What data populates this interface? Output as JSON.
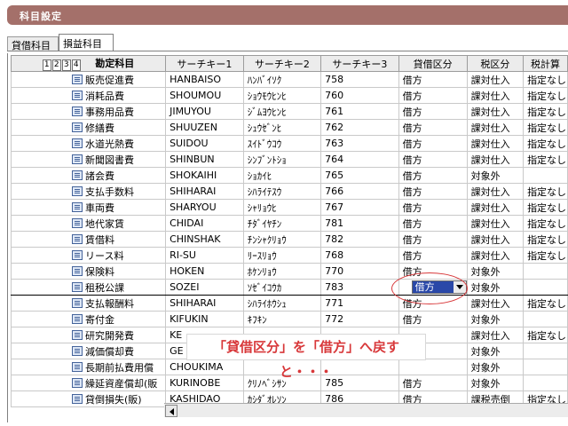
{
  "window": {
    "title": "科目設定"
  },
  "tabs": [
    {
      "label": "貸借科目",
      "active": false
    },
    {
      "label": "損益科目",
      "active": true
    }
  ],
  "grid": {
    "levels": [
      "1",
      "2",
      "3",
      "4"
    ],
    "headers": {
      "account": "勘定科目",
      "key1": "サーチキー1",
      "key2": "サーチキー2",
      "key3": "サーチキー3",
      "dc": "貸借区分",
      "tax": "税区分",
      "taxcalc": "税計算"
    },
    "rows": [
      {
        "name": "販売促進費",
        "key1": "HANBAISO",
        "key2": "ﾊﾝﾊﾞｲｿｸ",
        "key3": "758",
        "dc": "借方",
        "tax": "課対仕入",
        "taxcalc": "指定なし"
      },
      {
        "name": "消耗品費",
        "key1": "SHOUMOU",
        "key2": "ｼｮｳﾓｳﾋﾝﾋ",
        "key3": "760",
        "dc": "借方",
        "tax": "課対仕入",
        "taxcalc": "指定なし"
      },
      {
        "name": "事務用品費",
        "key1": "JIMUYOU",
        "key2": "ｼﾞﾑﾖｳﾋﾝﾋ",
        "key3": "761",
        "dc": "借方",
        "tax": "課対仕入",
        "taxcalc": "指定なし"
      },
      {
        "name": "修繕費",
        "key1": "SHUUZEN",
        "key2": "ｼｭｳｾﾞﾝﾋ",
        "key3": "762",
        "dc": "借方",
        "tax": "課対仕入",
        "taxcalc": "指定なし"
      },
      {
        "name": "水道光熱費",
        "key1": "SUIDOU",
        "key2": "ｽｲﾄﾞｳｺｳ",
        "key3": "763",
        "dc": "借方",
        "tax": "課対仕入",
        "taxcalc": "指定なし"
      },
      {
        "name": "新聞図書費",
        "key1": "SHINBUN",
        "key2": "ｼﾝﾌﾞﾝﾄｼｮ",
        "key3": "764",
        "dc": "借方",
        "tax": "課対仕入",
        "taxcalc": "指定なし"
      },
      {
        "name": "諸会費",
        "key1": "SHOKAIHI",
        "key2": "ｼｮｶｲﾋ",
        "key3": "765",
        "dc": "借方",
        "tax": "対象外",
        "taxcalc": ""
      },
      {
        "name": "支払手数料",
        "key1": "SHIHARAI",
        "key2": "ｼﾊﾗｲﾃｽｳ",
        "key3": "766",
        "dc": "借方",
        "tax": "課対仕入",
        "taxcalc": "指定なし"
      },
      {
        "name": "車両費",
        "key1": "SHARYOU",
        "key2": "ｼｬﾘｮｳﾋ",
        "key3": "767",
        "dc": "借方",
        "tax": "課対仕入",
        "taxcalc": "指定なし"
      },
      {
        "name": "地代家賃",
        "key1": "CHIDAI",
        "key2": "ﾁﾀﾞｲﾔﾁﾝ",
        "key3": "781",
        "dc": "借方",
        "tax": "課対仕入",
        "taxcalc": "指定なし"
      },
      {
        "name": "賃借料",
        "key1": "CHINSHAK",
        "key2": "ﾁﾝｼｬｸﾘｮｳ",
        "key3": "782",
        "dc": "借方",
        "tax": "課対仕入",
        "taxcalc": "指定なし"
      },
      {
        "name": "リース料",
        "key1": "RI-SU",
        "key2": "ﾘｰｽﾘｮｳ",
        "key3": "768",
        "dc": "借方",
        "tax": "課対仕入",
        "taxcalc": "指定なし"
      },
      {
        "name": "保険料",
        "key1": "HOKEN",
        "key2": "ﾎｹﾝﾘｮｳ",
        "key3": "770",
        "dc": "借方",
        "tax": "対象外",
        "taxcalc": ""
      },
      {
        "name": "租税公課",
        "key1": "SOZEI",
        "key2": "ｿｾﾞｲｺｳｶ",
        "key3": "783",
        "dc": "借方",
        "tax": "対象外",
        "taxcalc": "",
        "selected": true
      },
      {
        "name": "支払報酬料",
        "key1": "SHIHARAI",
        "key2": "ｼﾊﾗｲﾎｳｼｭ",
        "key3": "771",
        "dc": "借方",
        "tax": "課対仕入",
        "taxcalc": "指定なし"
      },
      {
        "name": "寄付金",
        "key1": "KIFUKIN",
        "key2": "ｷﾌｷﾝ",
        "key3": "772",
        "dc": "借方",
        "tax": "対象外",
        "taxcalc": ""
      },
      {
        "name": "研究開発費",
        "key1": "KE",
        "key2": "",
        "key3": "",
        "dc": "",
        "tax": "課対仕入",
        "taxcalc": "指定なし"
      },
      {
        "name": "減価償却費",
        "key1": "GE",
        "key2": "",
        "key3": "",
        "dc": "",
        "tax": "対象外",
        "taxcalc": ""
      },
      {
        "name": "長期前払費用償",
        "key1": "CHOUKIMA",
        "key2": "",
        "key3": "",
        "dc": "",
        "tax": "対象外",
        "taxcalc": ""
      },
      {
        "name": "繰延資産償却(販",
        "key1": "KURINOBE",
        "key2": "ｸﾘﾉﾍﾞｼｻﾝ",
        "key3": "785",
        "dc": "借方",
        "tax": "対象外",
        "taxcalc": ""
      },
      {
        "name": "貸倒損失(販)",
        "key1": "KASHIDAO",
        "key2": "ｶｼﾀﾞｵﾚｿﾝ",
        "key3": "786",
        "dc": "借方",
        "tax": "課税売倒",
        "taxcalc": "指定なし"
      }
    ],
    "combo_value": "借方"
  },
  "annotation": {
    "text": "「貸借区分」を「借方」へ戻すと・・・"
  }
}
